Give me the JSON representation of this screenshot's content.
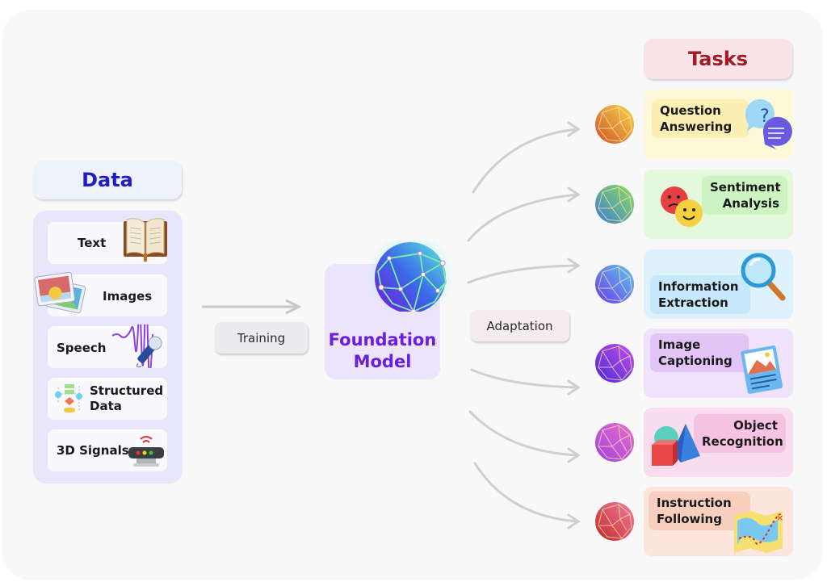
{
  "diagram": {
    "data_section": {
      "title": "Data",
      "items": [
        {
          "label": "Text",
          "icon": "book-icon"
        },
        {
          "label": "Images",
          "icon": "photos-icon"
        },
        {
          "label": "Speech",
          "icon": "microphone-icon"
        },
        {
          "label": "Structured Data",
          "label_lines": [
            "Structured",
            "Data"
          ],
          "icon": "flowchart-icon"
        },
        {
          "label": "3D Signals",
          "icon": "sensor-icon"
        }
      ]
    },
    "training_label": "Training",
    "foundation_model": {
      "label_lines": [
        "Foundation",
        "Model"
      ],
      "icon": "network-sphere-icon"
    },
    "adaptation_label": "Adaptation",
    "tasks_section": {
      "title": "Tasks",
      "items": [
        {
          "label_lines": [
            "Question",
            "Answering"
          ],
          "icon": "speech-bubbles-icon",
          "card_color": "#fdf9d8",
          "label_color": "#fbefb4",
          "sphere_colors": [
            "#f5d94a",
            "#d0502a"
          ]
        },
        {
          "label_lines": [
            "Sentiment",
            "Analysis"
          ],
          "icon": "emoji-faces-icon",
          "card_color": "#e4f9dc",
          "label_color": "#cdf3c2",
          "sphere_colors": [
            "#8ee05a",
            "#3a7ad8"
          ]
        },
        {
          "label_lines": [
            "Information",
            "Extraction"
          ],
          "icon": "magnifier-icon",
          "card_color": "#def2fd",
          "label_color": "#c6e8fa",
          "sphere_colors": [
            "#5ec8f0",
            "#6a3ae8"
          ]
        },
        {
          "label_lines": [
            "Image",
            "Captioning"
          ],
          "icon": "picture-caption-icon",
          "card_color": "#f1e2fb",
          "label_color": "#e2c4f6",
          "sphere_colors": [
            "#c050e8",
            "#4a2ad8"
          ]
        },
        {
          "label_lines": [
            "Object",
            "Recognition"
          ],
          "icon": "shapes-icon",
          "card_color": "#fadcef",
          "label_color": "#f6c2e2",
          "sphere_colors": [
            "#e870c8",
            "#a040e0"
          ]
        },
        {
          "label_lines": [
            "Instruction",
            "Following"
          ],
          "icon": "map-icon",
          "card_color": "#fbe5dd",
          "label_color": "#f8cfbe",
          "sphere_colors": [
            "#f080a0",
            "#c02828"
          ]
        }
      ]
    }
  }
}
